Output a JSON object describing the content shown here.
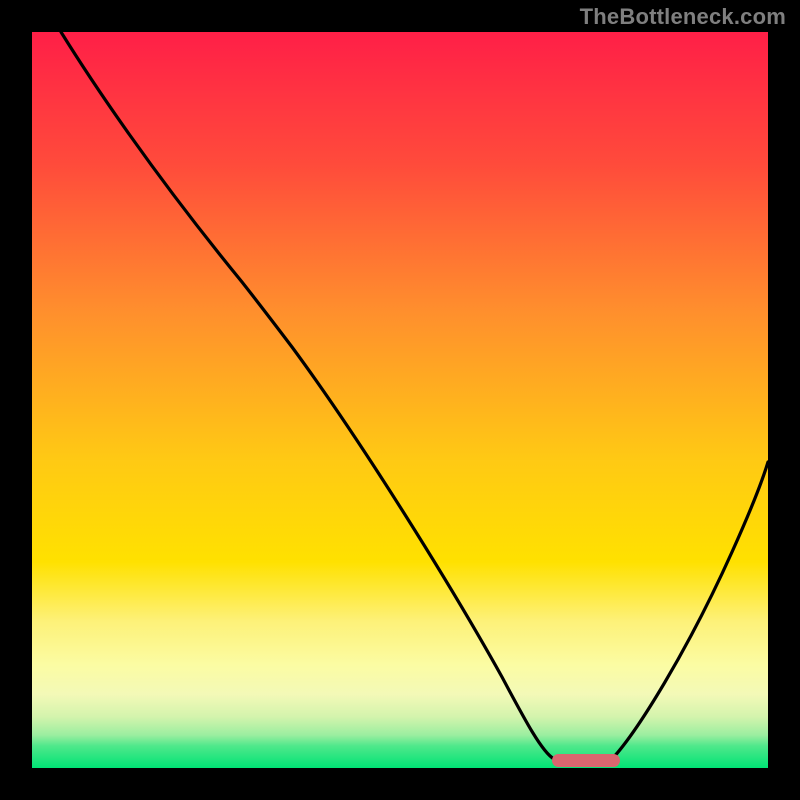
{
  "attribution": "TheBottleneck.com",
  "chart_data": {
    "type": "line",
    "title": "",
    "xlabel": "",
    "ylabel": "",
    "xlim": [
      0,
      100
    ],
    "ylim": [
      0,
      100
    ],
    "background_gradient": {
      "top_color": "#ff1f47",
      "mid_upper_color": "#ff8f2d",
      "mid_color": "#ffd500",
      "mid_lower_color": "#f9f25a",
      "band_color": "#fbfca3",
      "bottom_color": "#00e375"
    },
    "floor_band": {
      "y_start": 79,
      "y_end": 86,
      "color": "#fbfca3"
    },
    "green_strip": {
      "y_start": 97,
      "y_end": 100,
      "color": "#00e375"
    },
    "series": [
      {
        "name": "bottleneck-curve",
        "color": "#000000",
        "x": [
          4,
          10,
          18,
          26,
          30,
          38,
          46,
          54,
          60,
          64,
          68,
          70,
          74,
          78,
          84,
          90,
          96,
          100
        ],
        "y": [
          100,
          91,
          80,
          69,
          65,
          54,
          43,
          32,
          23,
          16,
          9,
          4,
          0,
          0,
          6,
          18,
          32,
          42
        ]
      }
    ],
    "optimum_marker": {
      "shape": "rounded-bar",
      "x_center": 76,
      "width": 9,
      "color": "#d9666f"
    }
  }
}
